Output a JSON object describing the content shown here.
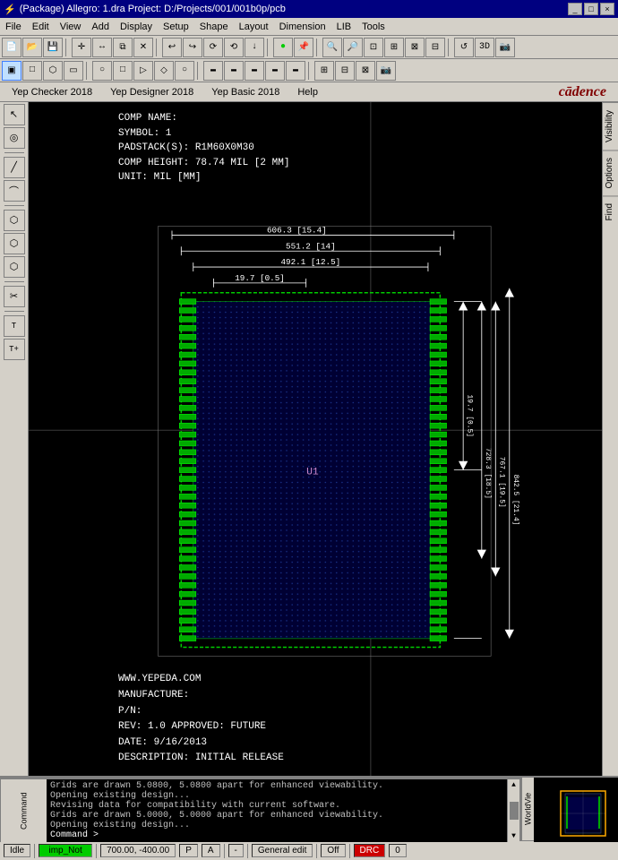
{
  "titlebar": {
    "title": "(Package) Allegro: 1.dra  Project: D:/Projects/001/001b0p/pcb",
    "icon": "⚡",
    "controls": [
      "_",
      "□",
      "×"
    ]
  },
  "menubar": {
    "items": [
      "File",
      "Edit",
      "View",
      "Add",
      "Display",
      "Setup",
      "Shape",
      "Layout",
      "Dimension",
      "LIB",
      "Tools"
    ]
  },
  "yepbar": {
    "items": [
      "Yep Checker 2018",
      "Yep Designer 2018",
      "Yep Basic 2018",
      "Help"
    ],
    "logo": "cādence"
  },
  "toolbar1": {
    "buttons": [
      "📁",
      "📂",
      "💾",
      "✂",
      "📋",
      "❌",
      "↩",
      "↪",
      "⟳",
      "⟲",
      "↓",
      "🔵",
      "📌",
      "🔍+",
      "🔍-",
      "🔍",
      "🔍",
      "🔎",
      "⬤",
      "🔄",
      "💿"
    ]
  },
  "toolbar2": {
    "buttons": [
      "□",
      "□",
      "□",
      "□",
      "▭",
      "○",
      "□",
      "▷",
      "◇",
      "○",
      "▭",
      "▭",
      "▭",
      "▭",
      "📷"
    ]
  },
  "left_toolbar": {
    "buttons": [
      "↖",
      "◉",
      "☰",
      "✏",
      "⬡",
      "⬡",
      "⬡",
      "✂",
      "T",
      "T+"
    ]
  },
  "right_panel": {
    "tabs": [
      "Visibility",
      "Options",
      "Find"
    ]
  },
  "component_info": {
    "line1": "COMP NAME:",
    "line2": "SYMBOL: 1",
    "line3": "PADSTACK(S): R1M60X0M30",
    "line4": "COMP HEIGHT: 78.74 MIL [2 MM]",
    "line5": "UNIT: MIL [MM]"
  },
  "dimensions": {
    "horiz": [
      "606.3 [15.4]",
      "551.2 [14]",
      "492.1 [12.5]",
      "19.7 [0.5]"
    ],
    "vert": [
      "19.7 [0.5]",
      "728.3 [18.5]",
      "767.1 [19.5]",
      "842.5 [21.4]"
    ]
  },
  "bottom_info": {
    "line1": "WWW.YEPEDA.COM",
    "line2": "MANUFACTURE:",
    "line3": "P/N:",
    "line4": "REV: 1.0  APPROVED: FUTURE",
    "line5": "DATE: 9/16/2013",
    "line6": "DESCRIPTION: INITIAL RELEASE"
  },
  "console": {
    "label": "Command",
    "lines": [
      "Grids are drawn 5.0800, 5.0800 apart for enhanced viewability.",
      "Opening existing design...",
      "Revising data for compatibility with current software.",
      "Grids are drawn 5.0000, 5.0000 apart for enhanced viewability.",
      "Opening existing design...",
      "Command >"
    ]
  },
  "worldview": {
    "label": "WorldVie"
  },
  "statusbar": {
    "mode": "Idle",
    "indicator": "imp_Not",
    "coordinates": "700.00, -400.00",
    "p_indicator": "P",
    "a_indicator": "A",
    "dash": "-",
    "edit_mode": "General edit",
    "off_label": "Off",
    "drc_label": "DRC",
    "drc_value": "0"
  }
}
